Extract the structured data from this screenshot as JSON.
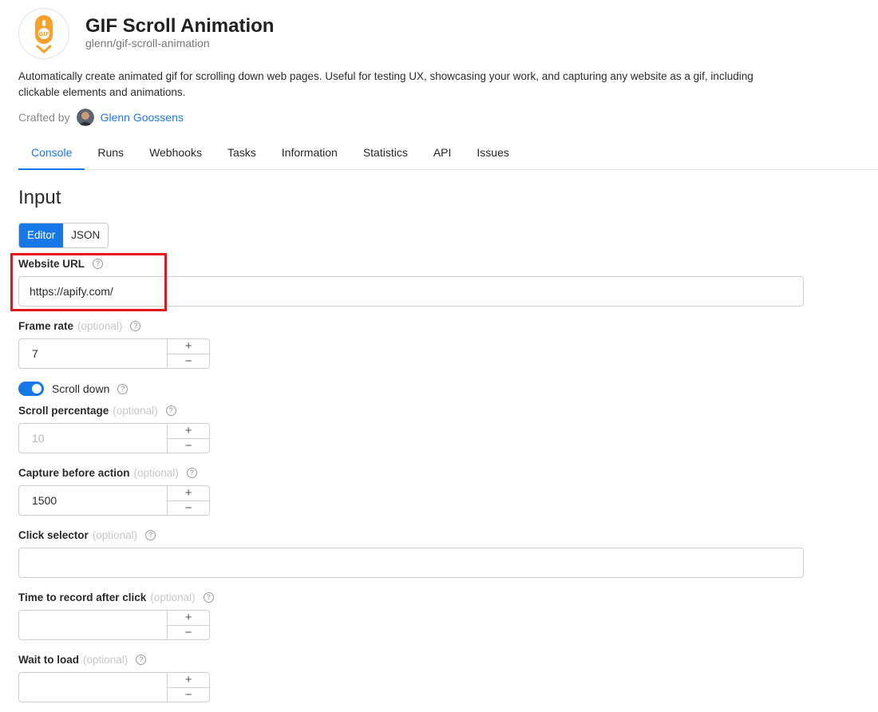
{
  "header": {
    "title": "GIF Scroll Animation",
    "slug": "glenn/gif-scroll-animation",
    "logo_text": "GIF",
    "description": "Automatically create animated gif for scrolling down web pages. Useful for testing UX, showcasing your work, and capturing any website as a gif, including clickable elements and animations.",
    "crafted_by_label": "Crafted by",
    "author": "Glenn Goossens"
  },
  "tabs": [
    {
      "label": "Console",
      "active": true
    },
    {
      "label": "Runs"
    },
    {
      "label": "Webhooks"
    },
    {
      "label": "Tasks"
    },
    {
      "label": "Information"
    },
    {
      "label": "Statistics"
    },
    {
      "label": "API"
    },
    {
      "label": "Issues"
    }
  ],
  "input": {
    "heading": "Input",
    "mode": {
      "editor": "Editor",
      "json": "JSON",
      "selected": "Editor"
    },
    "optional_label": "(optional)",
    "help_glyph": "?",
    "fields": {
      "website_url": {
        "label": "Website URL",
        "value": "https://apify.com/"
      },
      "frame_rate": {
        "label": "Frame rate",
        "value": "7"
      },
      "scroll_down": {
        "label": "Scroll down",
        "enabled": true
      },
      "scroll_percentage": {
        "label": "Scroll percentage",
        "placeholder": "10"
      },
      "capture_before_action": {
        "label": "Capture before action",
        "value": "1500"
      },
      "click_selector": {
        "label": "Click selector",
        "value": ""
      },
      "time_to_record_after_click": {
        "label": "Time to record after click",
        "value": ""
      },
      "wait_to_load": {
        "label": "Wait to load",
        "value": ""
      }
    },
    "stepper": {
      "plus": "+",
      "minus": "−"
    }
  },
  "colors": {
    "accent": "#1677e6",
    "highlight": "#e8141c",
    "logo_orange": "#f7a02b"
  }
}
